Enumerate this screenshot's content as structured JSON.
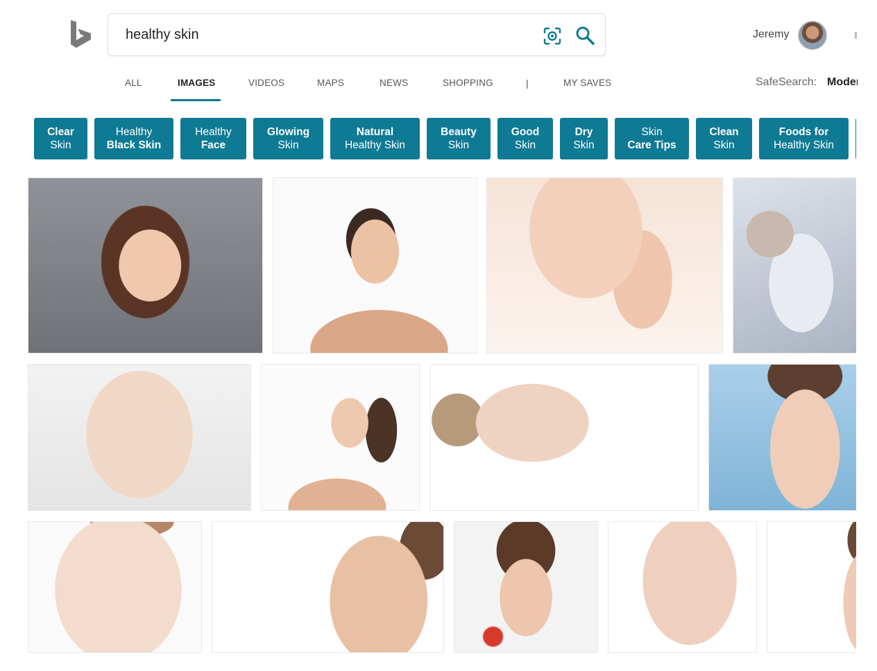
{
  "header": {
    "search": {
      "value": "healthy skin",
      "placeholder": ""
    },
    "user": {
      "name": "Jeremy"
    }
  },
  "nav": {
    "tabs": [
      {
        "label": "ALL"
      },
      {
        "label": "IMAGES"
      },
      {
        "label": "VIDEOS"
      },
      {
        "label": "MAPS"
      },
      {
        "label": "NEWS"
      },
      {
        "label": "SHOPPING"
      }
    ],
    "separator": "|",
    "my_saves": "MY SAVES",
    "safesearch_label": "SafeSearch:",
    "safesearch_value": "Moderate"
  },
  "related_searches": [
    {
      "line1": "Clear",
      "line2": "Skin"
    },
    {
      "line1": "Healthy",
      "line2": "Black Skin"
    },
    {
      "line1": "Healthy",
      "line2": "Face"
    },
    {
      "line1": "Glowing",
      "line2": "Skin"
    },
    {
      "line1": "Natural",
      "line2": "Healthy Skin"
    },
    {
      "line1": "Beauty",
      "line2": "Skin"
    },
    {
      "line1": "Good",
      "line2": "Skin"
    },
    {
      "line1": "Dry",
      "line2": "Skin"
    },
    {
      "line1": "Skin",
      "line2": "Care Tips"
    },
    {
      "line1": "Clean",
      "line2": "Skin"
    },
    {
      "line1": "Foods for",
      "line2": "Healthy Skin"
    }
  ],
  "colors": {
    "accent": "#0f7a94",
    "chip_text": "#ffffff"
  }
}
